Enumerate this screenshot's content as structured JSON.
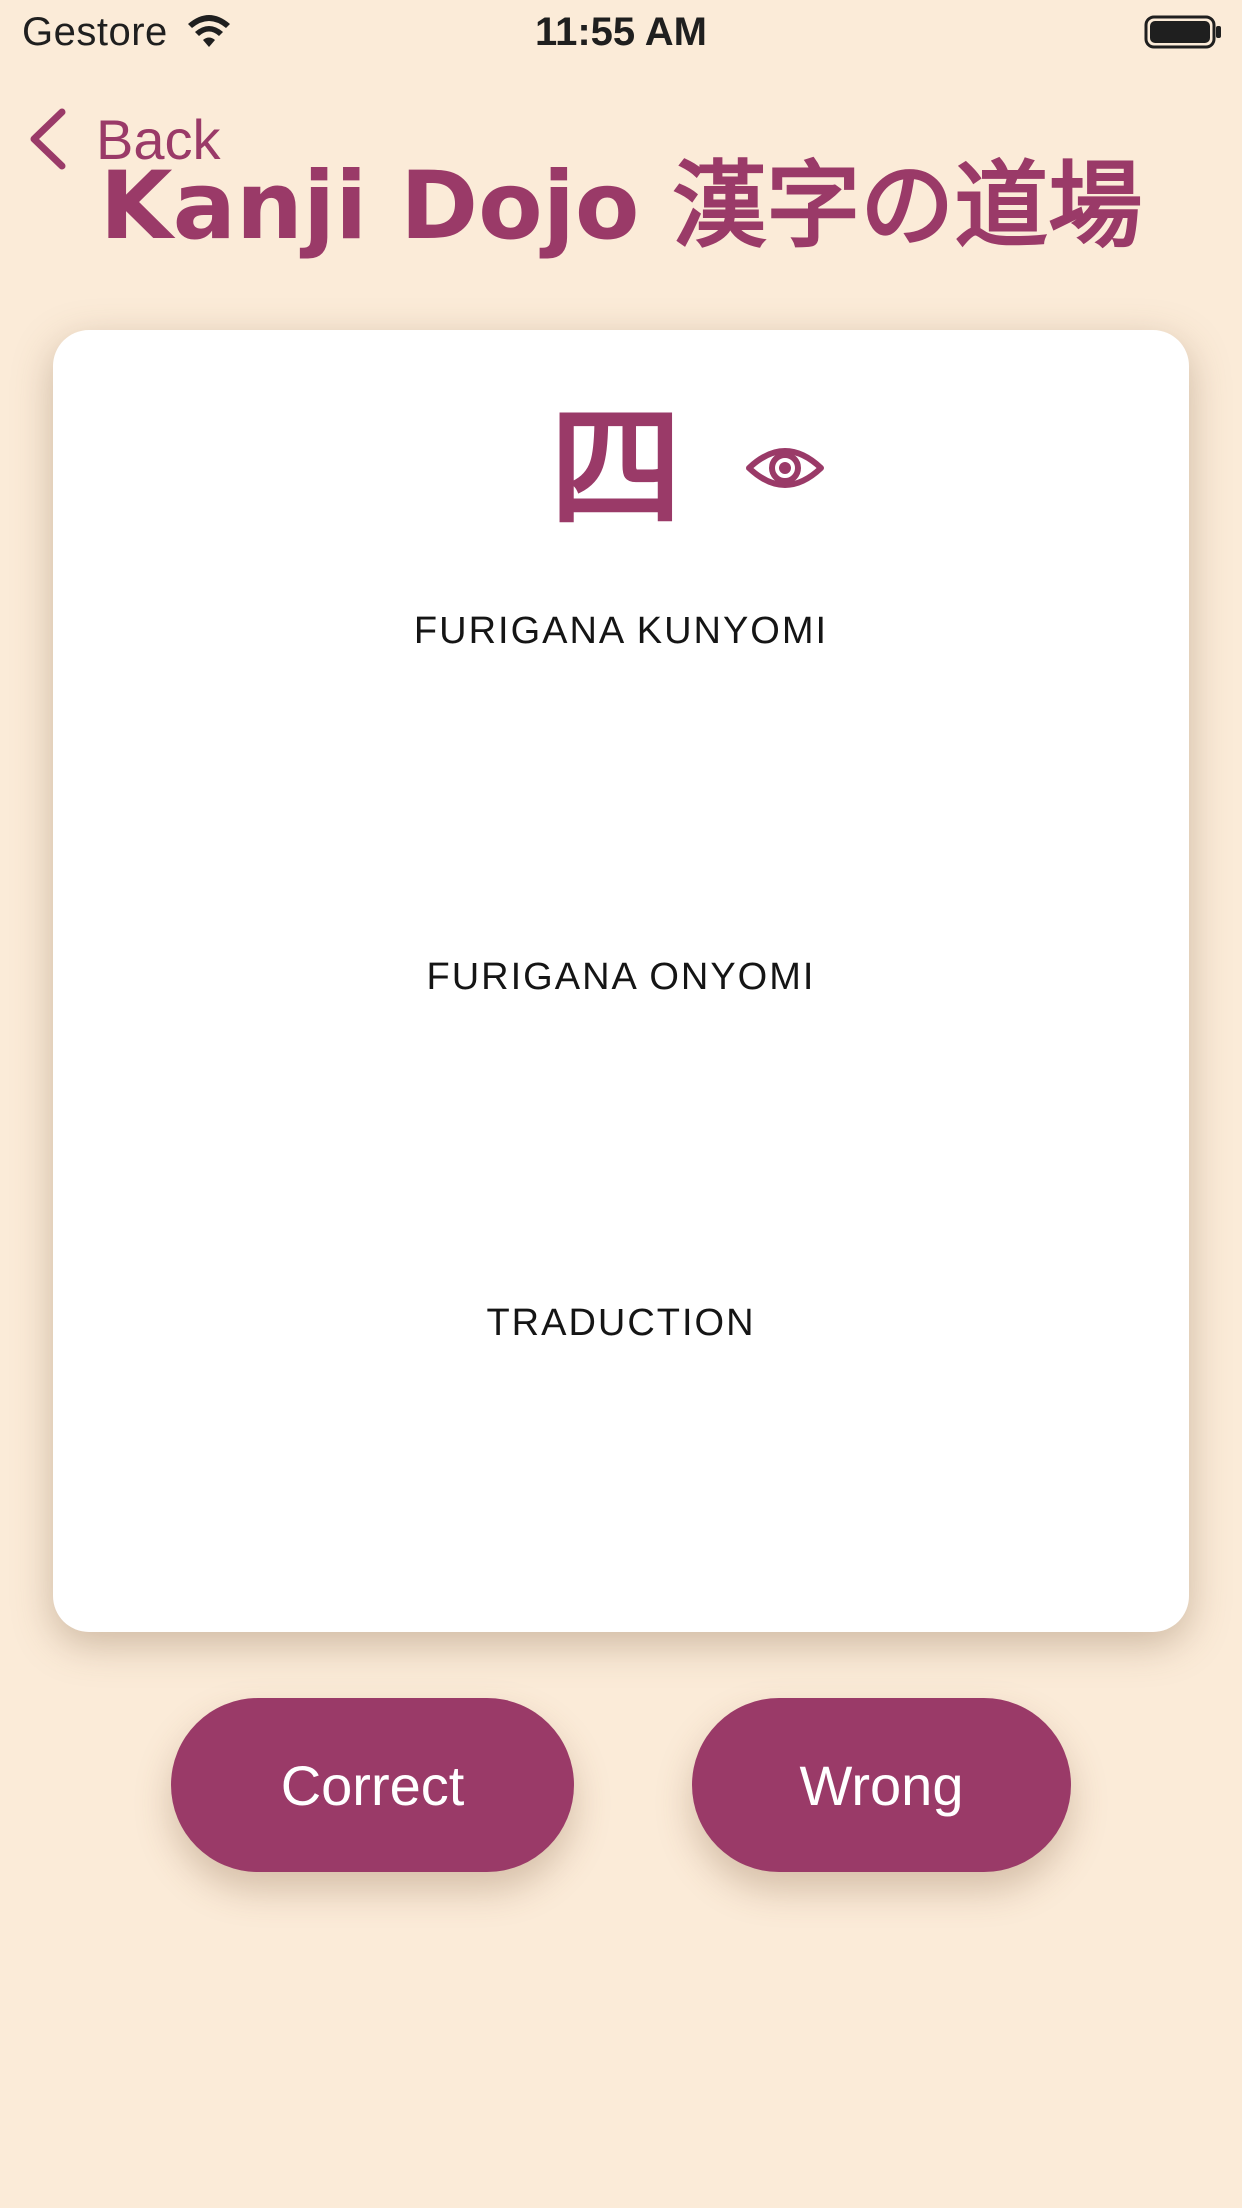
{
  "status_bar": {
    "carrier": "Gestore",
    "time": "11:55 AM",
    "icons": [
      "wifi-icon",
      "battery-icon"
    ]
  },
  "nav": {
    "back_label": "Back",
    "back_icon": "chevron-left-icon"
  },
  "header": {
    "title": "Kanji Dojo 漢字の道場"
  },
  "card": {
    "kanji": "四",
    "reveal_icon": "eye-icon",
    "kunyomi_label": "FURIGANA KUNYOMI",
    "onyomi_label": "FURIGANA ONYOMI",
    "translation_label": "TRADUCTION"
  },
  "actions": {
    "correct_label": "Correct",
    "wrong_label": "Wrong"
  },
  "colors": {
    "background": "#FBEBD8",
    "accent": "#9A3A68",
    "card": "#FFFFFF",
    "button_text": "#FFFFFF"
  }
}
